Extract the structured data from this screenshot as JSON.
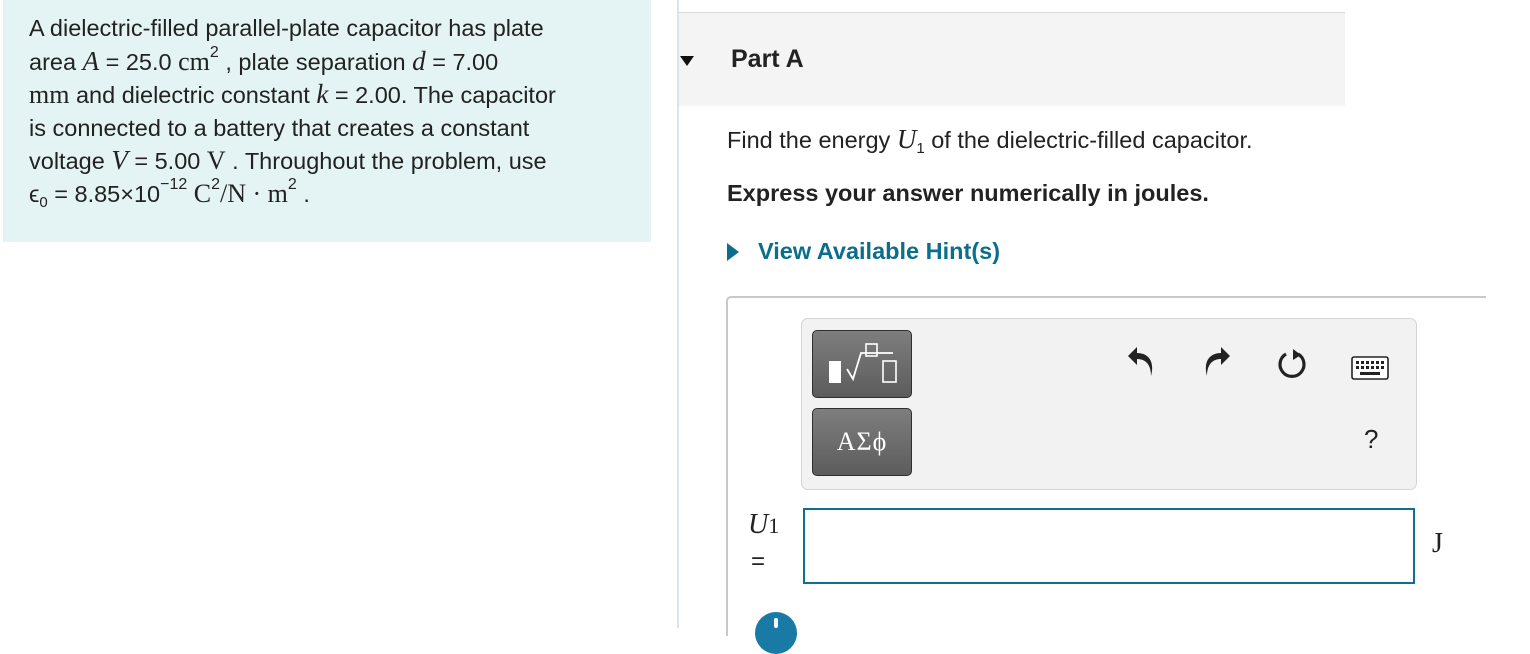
{
  "problem": {
    "l1": "A dielectric-filled parallel-plate capacitor has plate",
    "l2_a": "area ",
    "A_sym": "A",
    "l2_eq1": " = 25.0 ",
    "cm_unit": "cm",
    "cm_exp": "2",
    "l2_b": " , plate separation ",
    "d_sym": "d",
    "l2_eq2": " = 7.00",
    "mm_unit": "mm",
    "l3_a": " and dielectric constant ",
    "k_sym": "k",
    "l3_b": " = 2.00. The capacitor",
    "l4": "is connected to a battery that creates a constant",
    "l5_a": "voltage ",
    "V_sym": "V",
    "l5_b": " = 5.00 ",
    "V_unit": "V",
    "l5_c": " . Throughout the problem, use",
    "eps_sym": "ϵ",
    "eps_sub": "0",
    "l6_a": " = 8.85×10",
    "exp": "−12",
    "unit_a": " C",
    "unit_b": "2",
    "unit_c": "/N · m",
    "unit_d": "2",
    "l6_end": " ."
  },
  "part": {
    "title": "Part A"
  },
  "question": {
    "a": "Find the energy ",
    "U_sym": "U",
    "U_sub": "1",
    "b": " of the dielectric-filled capacitor."
  },
  "instruction": "Express your answer numerically in joules.",
  "hint": {
    "label": "View Available Hint(s)"
  },
  "toolbar": {
    "symbols_label": "ΑΣϕ",
    "help_label": "?"
  },
  "answer": {
    "U_sym": "U",
    "U_sub": "1",
    "equals": "=",
    "value": "",
    "unit": "J"
  },
  "icons": {
    "collapse": "caret-down-icon",
    "hint": "caret-right-icon",
    "templates": "templates-icon",
    "undo": "undo-icon",
    "redo": "redo-icon",
    "reset": "reset-icon",
    "keyboard": "keyboard-icon",
    "help": "help-icon",
    "info": "info-icon"
  },
  "colors": {
    "problem_bg": "#e4f4f5",
    "link": "#0b6e8c",
    "input_border": "#0e6f8e",
    "tool_button": "#6b6b6b"
  }
}
